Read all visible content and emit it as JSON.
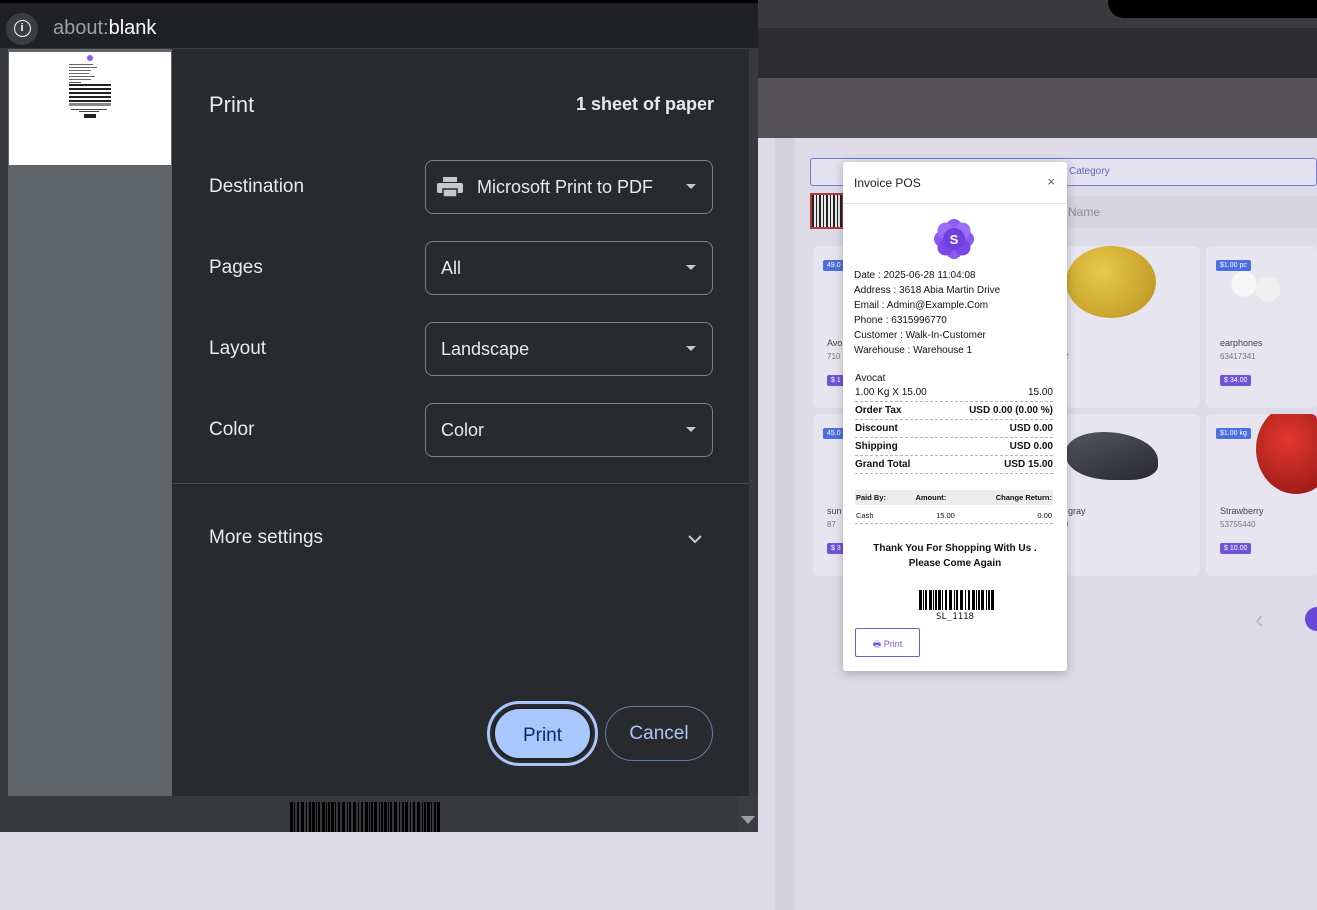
{
  "browser": {
    "url_prefix": "about:",
    "url_rest": "blank"
  },
  "print_dialog": {
    "title": "Print",
    "sheets": "1 sheet of paper",
    "destination": {
      "label": "Destination",
      "value": "Microsoft Print to PDF",
      "icon": "printer-icon"
    },
    "pages": {
      "label": "Pages",
      "value": "All"
    },
    "layout": {
      "label": "Layout",
      "value": "Landscape"
    },
    "color": {
      "label": "Color",
      "value": "Color"
    },
    "more_settings": "More settings",
    "print_button": "Print",
    "cancel_button": "Cancel",
    "colors": {
      "panel": "#292a2d",
      "accent": "#a8c7fa"
    }
  },
  "invoice": {
    "title": "Invoice POS",
    "close": "×",
    "logo_letter": "S",
    "info": [
      "Date : 2025-06-28 11:04:08",
      "Address : 3618 Abia Martin Drive",
      "Email : Admin@Example.Com",
      "Phone : 6315996770",
      "Customer : Walk-In-Customer",
      "Warehouse : Warehouse 1"
    ],
    "item": {
      "name": "Avocat",
      "qty_line": "1.00 Kg X 15.00",
      "amount": "15.00"
    },
    "totals": [
      {
        "label": "Order Tax",
        "value": "USD 0.00 (0.00 %)"
      },
      {
        "label": "Discount",
        "value": "USD 0.00"
      },
      {
        "label": "Shipping",
        "value": "USD 0.00"
      },
      {
        "label": "Grand Total",
        "value": "USD 15.00"
      }
    ],
    "payment": {
      "headers": [
        "Paid By:",
        "Amount:",
        "Change Return:"
      ],
      "row": [
        "Cash",
        "15.00",
        "0.00"
      ]
    },
    "thanks_line1": "Thank You For Shopping With Us .",
    "thanks_line2": "Please Come Again",
    "code": "SL_1118",
    "print_label": "Print",
    "accent": "#7b5ad0"
  },
  "background": {
    "category_placeholder": "Category",
    "name_placeholder": "Name",
    "products": [
      {
        "badge": "49.0",
        "name": "Avo",
        "code": "710",
        "price": "$ 1"
      },
      {
        "badge": "",
        "name": "",
        "code": "2",
        "price": ""
      },
      {
        "badge": "$1.00 pc",
        "name": "earphones",
        "code": "63417341",
        "price": "$ 34.00"
      },
      {
        "badge": "45.0",
        "name": "sun",
        "code": "87",
        "price": "$ 3"
      },
      {
        "badge": "",
        "name": "gray",
        "code": "9",
        "price": ""
      },
      {
        "badge": "$1.00 kg",
        "name": "Strawberry",
        "code": "53755440",
        "price": "$ 10.00"
      }
    ]
  }
}
